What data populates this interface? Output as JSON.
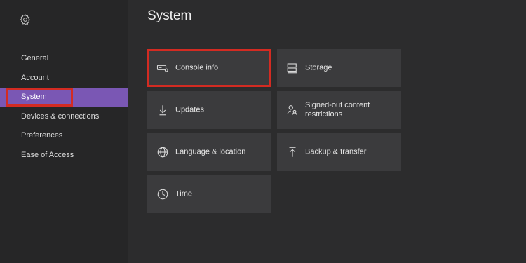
{
  "sidebar": {
    "icon": "gear-icon",
    "items": [
      {
        "label": "General"
      },
      {
        "label": "Account"
      },
      {
        "label": "System"
      },
      {
        "label": "Devices & connections"
      },
      {
        "label": "Preferences"
      },
      {
        "label": "Ease of Access"
      }
    ],
    "active_index": 2
  },
  "main": {
    "title": "System",
    "tiles": [
      {
        "label": "Console info",
        "icon": "console-icon",
        "highlighted": true
      },
      {
        "label": "Storage",
        "icon": "storage-icon"
      },
      {
        "label": "Updates",
        "icon": "download-arrow-icon"
      },
      {
        "label": "Signed-out content restrictions",
        "icon": "users-lock-icon"
      },
      {
        "label": "Language & location",
        "icon": "globe-icon"
      },
      {
        "label": "Backup & transfer",
        "icon": "upload-arrow-icon"
      },
      {
        "label": "Time",
        "icon": "clock-icon"
      }
    ]
  },
  "colors": {
    "accent": "#7a57b4",
    "highlight": "#d32b22",
    "background": "#2c2c2d",
    "tile": "#3b3b3d"
  }
}
